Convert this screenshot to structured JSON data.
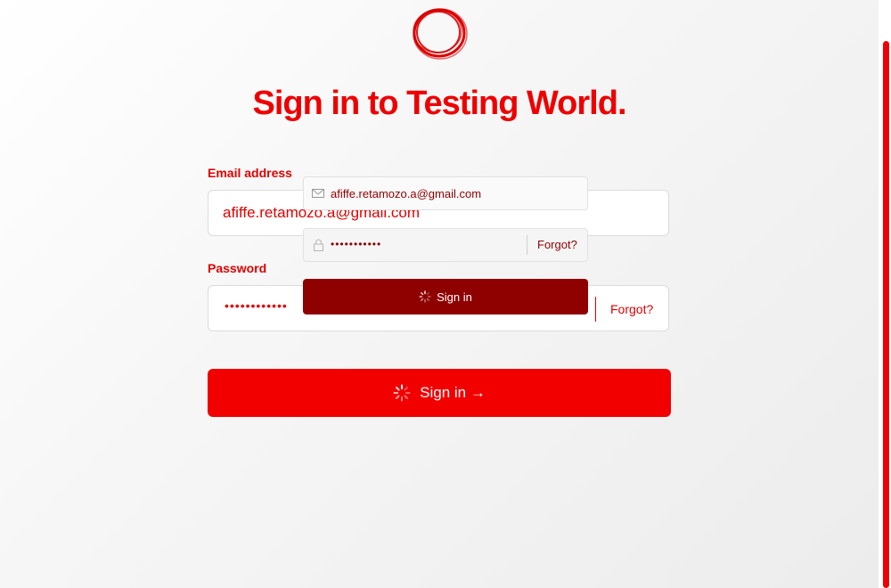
{
  "page": {
    "title": "Sign in to Testing World."
  },
  "form": {
    "email_label": "Email address",
    "email_value": "afiffe.retamozo.a@gmail.com",
    "password_label": "Password",
    "password_value": "••••••••••••",
    "forgot_label": "Forgot?",
    "submit_label": "Sign in →"
  },
  "overlay": {
    "email_value": "afiffe.retamozo.a@gmail.com",
    "password_value": "•••••••••••",
    "forgot_label": "Forgot?",
    "submit_label": "Sign in"
  },
  "colors": {
    "brand": "#f20000",
    "brand_dark": "#8f0000"
  },
  "icons": {
    "logo": "ring-logo-icon",
    "spinner": "spinner-icon",
    "mail": "mail-icon",
    "lock": "lock-icon"
  }
}
